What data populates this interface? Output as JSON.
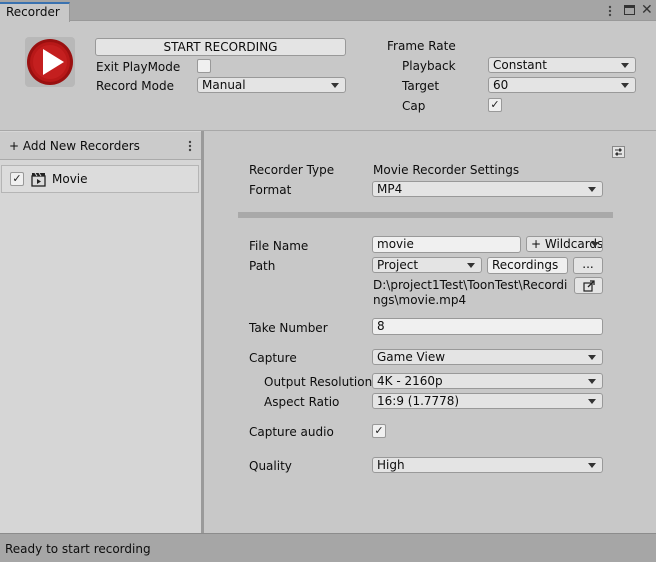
{
  "window": {
    "tab_title": "Recorder"
  },
  "header": {
    "start_button": "START RECORDING",
    "exit_playmode_label": "Exit PlayMode",
    "exit_playmode_checked": false,
    "record_mode_label": "Record Mode",
    "record_mode_value": "Manual",
    "frame_rate_title": "Frame Rate",
    "playback_label": "Playback",
    "playback_value": "Constant",
    "target_label": "Target",
    "target_value": "60",
    "cap_label": "Cap",
    "cap_checked": true
  },
  "sidebar": {
    "add_button": "+ Add New Recorders",
    "items": [
      {
        "label": "Movie",
        "enabled": true
      }
    ]
  },
  "settings": {
    "recorder_type_label": "Recorder Type",
    "recorder_type_value": "Movie Recorder Settings",
    "format_label": "Format",
    "format_value": "MP4",
    "file_name_label": "File Name",
    "file_name_value": "movie",
    "wildcards_button": "+ Wildcards",
    "path_label": "Path",
    "path_root_value": "Project",
    "path_folder_value": "Recordings",
    "browse_button": "...",
    "full_path_line1": "D:\\project1Test\\ToonTest\\Recordi",
    "full_path_line2": "ngs\\movie.mp4",
    "take_number_label": "Take Number",
    "take_number_value": "8",
    "capture_label": "Capture",
    "capture_value": "Game View",
    "output_resolution_label": "Output Resolution",
    "output_resolution_value": "4K - 2160p",
    "aspect_ratio_label": "Aspect Ratio",
    "aspect_ratio_value": "16:9 (1.7778)",
    "capture_audio_label": "Capture audio",
    "capture_audio_checked": true,
    "quality_label": "Quality",
    "quality_value": "High"
  },
  "status_bar": {
    "text": "Ready to start recording"
  },
  "icons": {
    "play": "play-icon",
    "kebab": "kebab-menu-icon",
    "lock": "lock-icon",
    "maximize": "maximize-icon",
    "preset": "preset-icon",
    "open_folder": "open-external-icon",
    "movie": "clapperboard-icon"
  },
  "colors": {
    "window_bg": "#c8c8c8",
    "panel_bg": "#d6d6d6",
    "record_red": "#b01515",
    "status_bar": "#a6a6a6"
  }
}
